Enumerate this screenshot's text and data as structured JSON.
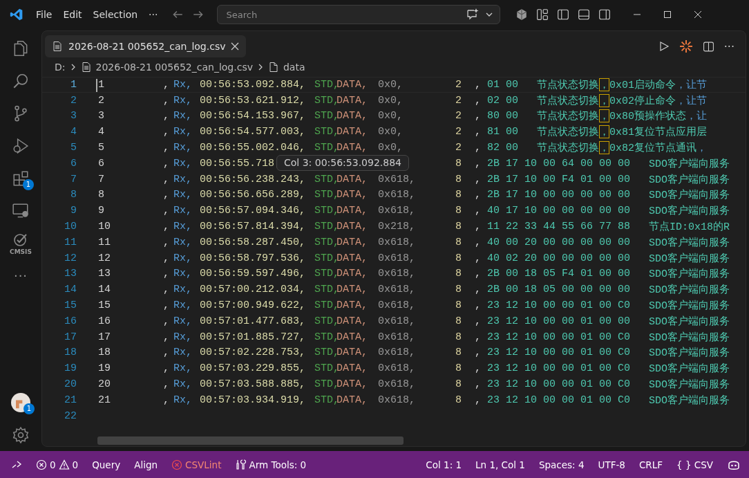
{
  "menu": [
    {
      "label": "File"
    },
    {
      "label": "Edit"
    },
    {
      "label": "Selection"
    },
    {
      "label": "···"
    }
  ],
  "search": {
    "placeholder": "Search"
  },
  "activity_bar": [
    {
      "kind": "files"
    },
    {
      "kind": "search"
    },
    {
      "kind": "source"
    },
    {
      "kind": "debug"
    },
    {
      "kind": "extensions",
      "badge": "1"
    },
    {
      "kind": "remote"
    },
    {
      "kind": "cmsis",
      "label": "CMSIS"
    },
    {
      "kind": "more",
      "label": "···"
    }
  ],
  "account": {
    "badge": "1"
  },
  "tab": {
    "title": "2026-08-21 005652_can_log.csv",
    "selected": true
  },
  "tab_actions": {
    "more": "···"
  },
  "breadcrumb": [
    {
      "text": "D:",
      "kind": "drive"
    },
    {
      "text": "2026-08-21 005652_can_log.csv",
      "kind": "file"
    },
    {
      "text": "data",
      "kind": "symbol"
    }
  ],
  "lines": [
    {
      "line": "1",
      "current": true,
      "cells": {
        "index": "1",
        "lead": ",",
        "dir": "Rx,",
        "time": "00:56:53.092.884,",
        "type": "STD,",
        "frame": "DATA,",
        "id": "0x0,",
        "dlc": "2",
        "sep": ",",
        "data": "01 00"
      },
      "comment": [
        {
          "text": "节点状态切换",
          "kind": "text"
        },
        {
          "text": "，",
          "kind": "match"
        },
        {
          "text": "0x01启动命令",
          "kind": "text"
        },
        {
          "text": "，让节",
          "kind": "next"
        }
      ]
    },
    {
      "line": "2",
      "current": false,
      "cells": {
        "index": "2",
        "lead": ",",
        "dir": "Rx,",
        "time": "00:56:53.621.912,",
        "type": "STD,",
        "frame": "DATA,",
        "id": "0x0,",
        "dlc": "2",
        "sep": ",",
        "data": "02 00"
      },
      "comment": [
        {
          "text": "节点状态切换",
          "kind": "text"
        },
        {
          "text": "，",
          "kind": "match"
        },
        {
          "text": "0x02停止命令",
          "kind": "text"
        },
        {
          "text": "，让节",
          "kind": "next"
        }
      ]
    },
    {
      "line": "3",
      "current": false,
      "cells": {
        "index": "3",
        "lead": ",",
        "dir": "Rx,",
        "time": "00:56:54.153.967,",
        "type": "STD,",
        "frame": "DATA,",
        "id": "0x0,",
        "dlc": "2",
        "sep": ",",
        "data": "80 00"
      },
      "comment": [
        {
          "text": "节点状态切换",
          "kind": "text"
        },
        {
          "text": "，",
          "kind": "match"
        },
        {
          "text": "0x80预操作状态",
          "kind": "text"
        },
        {
          "text": "，让",
          "kind": "next"
        }
      ]
    },
    {
      "line": "4",
      "current": false,
      "cells": {
        "index": "4",
        "lead": ",",
        "dir": "Rx,",
        "time": "00:56:54.577.003,",
        "type": "STD,",
        "frame": "DATA,",
        "id": "0x0,",
        "dlc": "2",
        "sep": ",",
        "data": "81 00"
      },
      "comment": [
        {
          "text": "节点状态切换",
          "kind": "text"
        },
        {
          "text": "，",
          "kind": "match"
        },
        {
          "text": "0x81复位节点应用层",
          "kind": "text"
        }
      ]
    },
    {
      "line": "5",
      "current": false,
      "cells": {
        "index": "5",
        "lead": ",",
        "dir": "Rx,",
        "time": "00:56:55.002.046,",
        "type": "STD,",
        "frame": "DATA,",
        "id": "0x0,",
        "dlc": "2",
        "sep": ",",
        "data": "82 00"
      },
      "comment": [
        {
          "text": "节点状态切换",
          "kind": "text"
        },
        {
          "text": "，",
          "kind": "match"
        },
        {
          "text": "0x82复位节点通讯",
          "kind": "text"
        },
        {
          "text": "，",
          "kind": "next"
        }
      ]
    },
    {
      "line": "6",
      "current": false,
      "cells": {
        "index": "6",
        "lead": ",",
        "dir": "Rx,",
        "time": "00:56:55.718",
        "dlc": "8",
        "sep": ",",
        "data": "2B 17 10 00 64 00 00 00"
      },
      "comment": [
        {
          "text": "SDO客户端向服务",
          "kind": "text"
        }
      ]
    },
    {
      "line": "7",
      "current": false,
      "cells": {
        "index": "7",
        "lead": ",",
        "dir": "Rx,",
        "time": "00:56:56.238.243,",
        "type": "STD,",
        "frame": "DATA,",
        "id": "0x618,",
        "dlc": "8",
        "sep": ",",
        "data": "2B 17 10 00 F4 01 00 00"
      },
      "comment": [
        {
          "text": "SDO客户端向服务",
          "kind": "text"
        }
      ]
    },
    {
      "line": "8",
      "current": false,
      "cells": {
        "index": "8",
        "lead": ",",
        "dir": "Rx,",
        "time": "00:56:56.656.289,",
        "type": "STD,",
        "frame": "DATA,",
        "id": "0x618,",
        "dlc": "8",
        "sep": ",",
        "data": "2B 17 10 00 00 00 00 00"
      },
      "comment": [
        {
          "text": "SDO客户端向服务",
          "kind": "text"
        }
      ]
    },
    {
      "line": "9",
      "current": false,
      "cells": {
        "index": "9",
        "lead": ",",
        "dir": "Rx,",
        "time": "00:56:57.094.346,",
        "type": "STD,",
        "frame": "DATA,",
        "id": "0x618,",
        "dlc": "8",
        "sep": ",",
        "data": "40 17 10 00 00 00 00 00"
      },
      "comment": [
        {
          "text": "SDO客户端向服务",
          "kind": "text"
        }
      ]
    },
    {
      "line": "10",
      "current": false,
      "cells": {
        "index": "10",
        "lead": ",",
        "dir": "Rx,",
        "time": "00:56:57.814.394,",
        "type": "STD,",
        "frame": "DATA,",
        "id": "0x218,",
        "dlc": "8",
        "sep": ",",
        "data": "11 22 33 44 55 66 77 88"
      },
      "comment": [
        {
          "text": "节点ID:0x18的R",
          "kind": "text"
        }
      ]
    },
    {
      "line": "11",
      "current": false,
      "cells": {
        "index": "11",
        "lead": ",",
        "dir": "Rx,",
        "time": "00:56:58.287.450,",
        "type": "STD,",
        "frame": "DATA,",
        "id": "0x618,",
        "dlc": "8",
        "sep": ",",
        "data": "40 00 20 00 00 00 00 00"
      },
      "comment": [
        {
          "text": "SDO客户端向服务",
          "kind": "text"
        }
      ]
    },
    {
      "line": "12",
      "current": false,
      "cells": {
        "index": "12",
        "lead": ",",
        "dir": "Rx,",
        "time": "00:56:58.797.536,",
        "type": "STD,",
        "frame": "DATA,",
        "id": "0x618,",
        "dlc": "8",
        "sep": ",",
        "data": "40 02 20 00 00 00 00 00"
      },
      "comment": [
        {
          "text": "SDO客户端向服务",
          "kind": "text"
        }
      ]
    },
    {
      "line": "13",
      "current": false,
      "cells": {
        "index": "13",
        "lead": ",",
        "dir": "Rx,",
        "time": "00:56:59.597.496,",
        "type": "STD,",
        "frame": "DATA,",
        "id": "0x618,",
        "dlc": "8",
        "sep": ",",
        "data": "2B 00 18 05 F4 01 00 00"
      },
      "comment": [
        {
          "text": "SDO客户端向服务",
          "kind": "text"
        }
      ]
    },
    {
      "line": "14",
      "current": false,
      "cells": {
        "index": "14",
        "lead": ",",
        "dir": "Rx,",
        "time": "00:57:00.212.034,",
        "type": "STD,",
        "frame": "DATA,",
        "id": "0x618,",
        "dlc": "8",
        "sep": ",",
        "data": "2B 00 18 05 00 00 00 00"
      },
      "comment": [
        {
          "text": "SDO客户端向服务",
          "kind": "text"
        }
      ]
    },
    {
      "line": "15",
      "current": false,
      "cells": {
        "index": "15",
        "lead": ",",
        "dir": "Rx,",
        "time": "00:57:00.949.622,",
        "type": "STD,",
        "frame": "DATA,",
        "id": "0x618,",
        "dlc": "8",
        "sep": ",",
        "data": "23 12 10 00 00 01 00 C0"
      },
      "comment": [
        {
          "text": "SDO客户端向服务",
          "kind": "text"
        }
      ]
    },
    {
      "line": "16",
      "current": false,
      "cells": {
        "index": "16",
        "lead": ",",
        "dir": "Rx,",
        "time": "00:57:01.477.683,",
        "type": "STD,",
        "frame": "DATA,",
        "id": "0x618,",
        "dlc": "8",
        "sep": ",",
        "data": "23 12 10 00 00 01 00 00"
      },
      "comment": [
        {
          "text": "SDO客户端向服务",
          "kind": "text"
        }
      ]
    },
    {
      "line": "17",
      "current": false,
      "cells": {
        "index": "17",
        "lead": ",",
        "dir": "Rx,",
        "time": "00:57:01.885.727,",
        "type": "STD,",
        "frame": "DATA,",
        "id": "0x618,",
        "dlc": "8",
        "sep": ",",
        "data": "23 12 10 00 00 01 00 C0"
      },
      "comment": [
        {
          "text": "SDO客户端向服务",
          "kind": "text"
        }
      ]
    },
    {
      "line": "18",
      "current": false,
      "cells": {
        "index": "18",
        "lead": ",",
        "dir": "Rx,",
        "time": "00:57:02.228.753,",
        "type": "STD,",
        "frame": "DATA,",
        "id": "0x618,",
        "dlc": "8",
        "sep": ",",
        "data": "23 12 10 00 00 01 00 C0"
      },
      "comment": [
        {
          "text": "SDO客户端向服务",
          "kind": "text"
        }
      ]
    },
    {
      "line": "19",
      "current": false,
      "cells": {
        "index": "19",
        "lead": ",",
        "dir": "Rx,",
        "time": "00:57:03.229.855,",
        "type": "STD,",
        "frame": "DATA,",
        "id": "0x618,",
        "dlc": "8",
        "sep": ",",
        "data": "23 12 10 00 00 01 00 C0"
      },
      "comment": [
        {
          "text": "SDO客户端向服务",
          "kind": "text"
        }
      ]
    },
    {
      "line": "20",
      "current": false,
      "cells": {
        "index": "20",
        "lead": ",",
        "dir": "Rx,",
        "time": "00:57:03.588.885,",
        "type": "STD,",
        "frame": "DATA,",
        "id": "0x618,",
        "dlc": "8",
        "sep": ",",
        "data": "23 12 10 00 00 01 00 C0"
      },
      "comment": [
        {
          "text": "SDO客户端向服务",
          "kind": "text"
        }
      ]
    },
    {
      "line": "21",
      "current": false,
      "cells": {
        "index": "21",
        "lead": ",",
        "dir": "Rx,",
        "time": "00:57:03.934.919,",
        "type": "STD,",
        "frame": "DATA,",
        "id": "0x618,",
        "dlc": "8",
        "sep": ",",
        "data": "23 12 10 00 00 01 00 C0"
      },
      "comment": [
        {
          "text": "SDO客户端向服务",
          "kind": "text"
        }
      ]
    },
    {
      "line": "22",
      "current": false
    }
  ],
  "tooltip": {
    "text": "Col 3: 00:56:53.092.884"
  },
  "status_bar": {
    "errors": "0",
    "warnings": "0",
    "left": [
      {
        "text": "Query",
        "kind": "plain"
      },
      {
        "text": "Align",
        "kind": "plain"
      },
      {
        "text": "CSVLint",
        "kind": "error"
      },
      {
        "text": "Arm Tools: 0",
        "kind": "tools"
      }
    ],
    "right": [
      {
        "text": "Col 1: 1"
      },
      {
        "text": "Ln 1, Col 1"
      },
      {
        "text": "Spaces: 4"
      },
      {
        "text": "UTF-8"
      },
      {
        "text": "CRLF"
      },
      {
        "text": "{ } CSV"
      }
    ]
  }
}
